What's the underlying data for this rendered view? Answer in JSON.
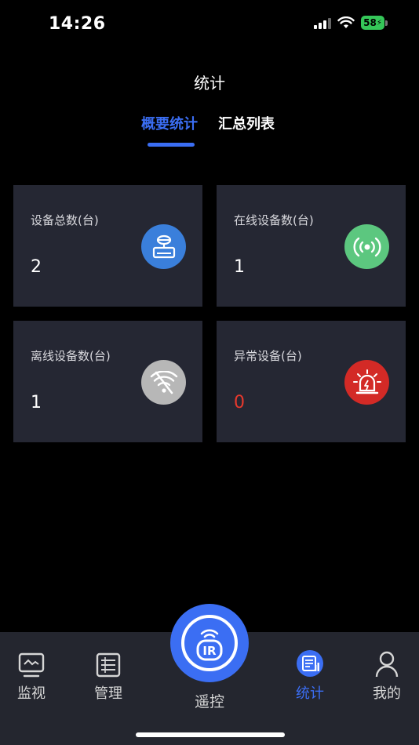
{
  "status_bar": {
    "time": "14:26",
    "battery": "58"
  },
  "header": {
    "title": "统计"
  },
  "tabs": [
    {
      "label": "概要统计",
      "active": true
    },
    {
      "label": "汇总列表",
      "active": false
    }
  ],
  "cards": [
    {
      "label": "设备总数(台)",
      "value": "2",
      "icon": "device-icon",
      "color": "#3a7fdb"
    },
    {
      "label": "在线设备数(台)",
      "value": "1",
      "icon": "online-signal-icon",
      "color": "#5cc77f"
    },
    {
      "label": "离线设备数(台)",
      "value": "1",
      "icon": "wifi-off-icon",
      "color": "#b7b7b7"
    },
    {
      "label": "异常设备(台)",
      "value": "0",
      "icon": "alarm-icon",
      "color": "#d32a26"
    }
  ],
  "tabbar": {
    "items": [
      {
        "label": "监视",
        "icon": "monitor-icon"
      },
      {
        "label": "管理",
        "icon": "manage-icon"
      },
      {
        "label": "遥控",
        "icon": "ir-remote-icon",
        "center": true
      },
      {
        "label": "统计",
        "icon": "stats-icon",
        "active": true
      },
      {
        "label": "我的",
        "icon": "profile-icon"
      }
    ],
    "center_badge": "IR"
  },
  "colors": {
    "accent": "#3b6ef3",
    "card_bg": "#252733",
    "alert": "#e8392d"
  }
}
